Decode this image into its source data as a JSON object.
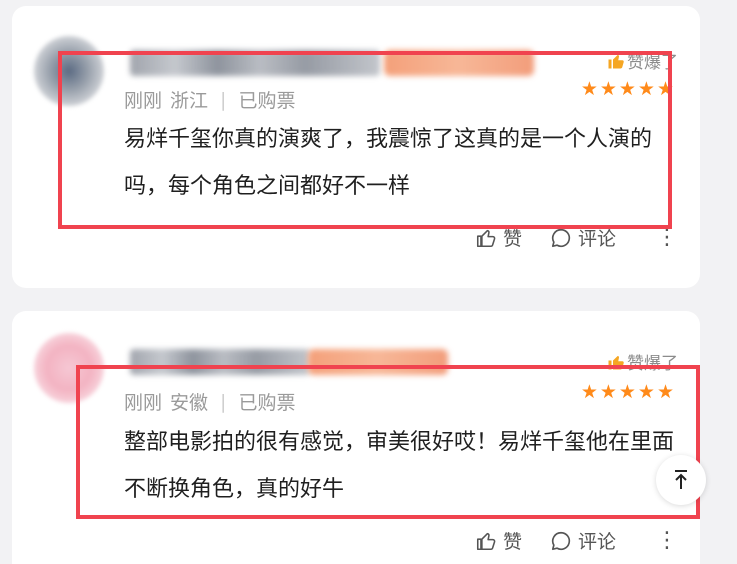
{
  "comments": [
    {
      "badge": "赞爆了",
      "time": "刚刚",
      "location": "浙江",
      "purchase": "已购票",
      "stars": "★★★★★",
      "text": "易烊千玺你真的演爽了，我震惊了这真的是一个人演的吗，每个角色之间都好不一样",
      "like_label": "赞",
      "comment_label": "评论",
      "more": "⋮"
    },
    {
      "badge": "赞爆了",
      "time": "刚刚",
      "location": "安徽",
      "purchase": "已购票",
      "stars": "★★★★★",
      "text": "整部电影拍的很有感觉，审美很好哎！易烊千玺他在里面不断换角色，真的好牛",
      "like_label": "赞",
      "comment_label": "评论",
      "more": "⋮"
    }
  ],
  "colors": {
    "highlight": "#f0434f",
    "stars": "#ff8a1a",
    "badge": "#f5a623"
  },
  "icons": {
    "badge": "thumbs-up-icon",
    "like": "thumb-outline-icon",
    "comment": "comment-bubble-icon",
    "more": "more-vertical-icon",
    "back_to_top": "arrow-to-top-icon"
  }
}
